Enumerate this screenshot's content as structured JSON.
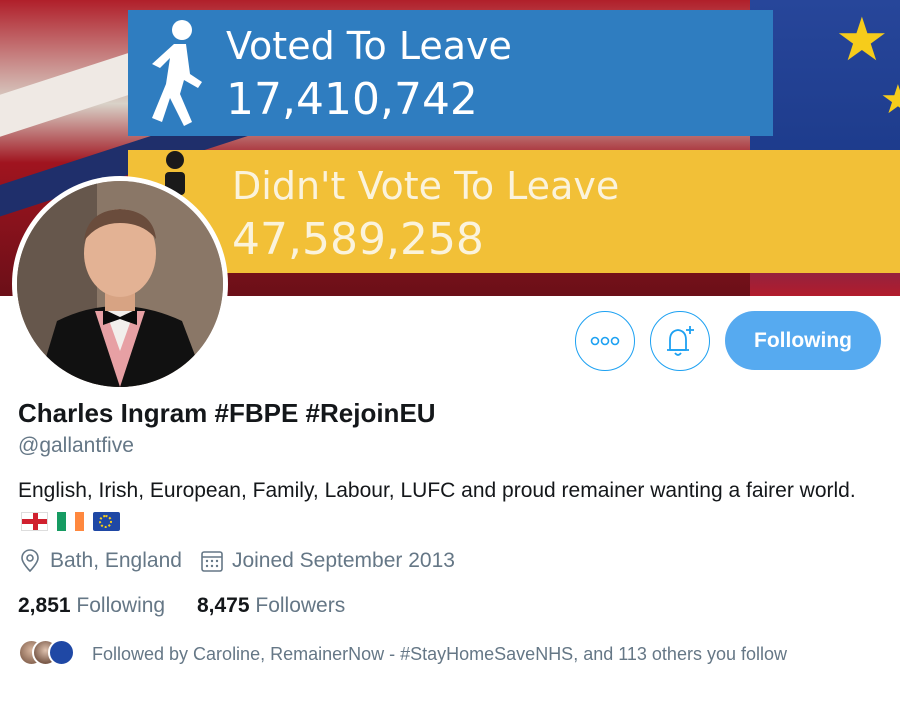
{
  "banner": {
    "blue_panel": {
      "label": "Voted To Leave",
      "count": "17,410,742"
    },
    "yellow_panel": {
      "label": "Didn't Vote To Leave",
      "count": "47,589,258"
    }
  },
  "actions": {
    "more_icon": "more-horizontal",
    "notify_icon": "bell-plus",
    "follow_label": "Following"
  },
  "profile": {
    "name": "Charles Ingram #FBPE #RejoinEU",
    "handle": "@gallantfive",
    "bio": "English, Irish, European, Family, Labour, LUFC and proud remainer wanting a fairer world.",
    "location": "Bath, England",
    "joined": "Joined September 2013"
  },
  "stats": {
    "following_count": "2,851",
    "following_label": "Following",
    "followers_count": "8,475",
    "followers_label": "Followers"
  },
  "followed_by": {
    "text": "Followed by Caroline, RemainerNow - #StayHomeSaveNHS, and 113 others you follow"
  },
  "colors": {
    "accent": "#1da1f2",
    "follow_button": "#56aaf0",
    "secondary_text": "#657786",
    "banner_blue": "#2f7dc0",
    "banner_yellow": "#f2c037"
  }
}
